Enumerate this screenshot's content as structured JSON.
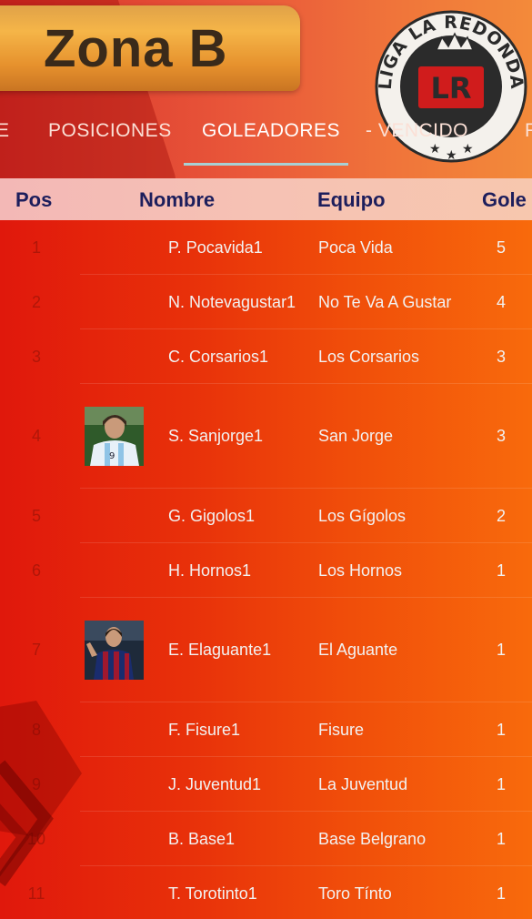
{
  "header": {
    "title": "Zona B",
    "logo_text": "LIGA LA REDONDA",
    "logo_initials": "LR"
  },
  "tabs": [
    {
      "label": "E"
    },
    {
      "label": "POSICIONES"
    },
    {
      "label": "GOLEADORES",
      "active": true
    },
    {
      "label": "- VENCIDO"
    },
    {
      "label": "FAI"
    }
  ],
  "table": {
    "headers": {
      "pos": "Pos",
      "nombre": "Nombre",
      "equipo": "Equipo",
      "goles": "Gole"
    },
    "rows": [
      {
        "pos": "1",
        "nombre": "P. Pocavida1",
        "equipo": "Poca Vida",
        "goles": "5"
      },
      {
        "pos": "2",
        "nombre": "N. Notevagustar1",
        "equipo": "No Te Va A Gustar",
        "goles": "4"
      },
      {
        "pos": "3",
        "nombre": "C. Corsarios1",
        "equipo": "Los Corsarios",
        "goles": "3"
      },
      {
        "pos": "4",
        "nombre": "S. Sanjorge1",
        "equipo": "San Jorge",
        "goles": "3"
      },
      {
        "pos": "5",
        "nombre": "G. Gigolos1",
        "equipo": "Los Gígolos",
        "goles": "2"
      },
      {
        "pos": "6",
        "nombre": "H. Hornos1",
        "equipo": "Los Hornos",
        "goles": "1"
      },
      {
        "pos": "7",
        "nombre": "E. Elaguante1",
        "equipo": "El Aguante",
        "goles": "1"
      },
      {
        "pos": "8",
        "nombre": "F. Fisure1",
        "equipo": "Fisure",
        "goles": "1"
      },
      {
        "pos": "9",
        "nombre": "J. Juventud1",
        "equipo": "La Juventud",
        "goles": "1"
      },
      {
        "pos": "10",
        "nombre": "B. Base1",
        "equipo": "Base Belgrano",
        "goles": "1"
      },
      {
        "pos": "11",
        "nombre": "T. Torotinto1",
        "equipo": "Toro Tínto",
        "goles": "1"
      }
    ]
  },
  "colors": {
    "background_start": "#e0180c",
    "background_end": "#f86a0c",
    "header_text": "#1d1e5c",
    "banner": "#f5b548"
  }
}
